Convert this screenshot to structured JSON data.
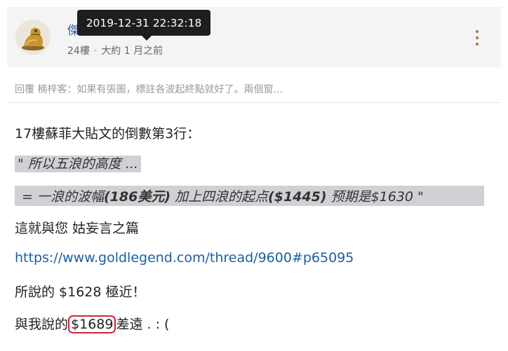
{
  "post": {
    "author": "傑",
    "floor": "24樓",
    "relative_time": "大約 1 月之前",
    "tooltip_datetime": "2019-12-31 22:32:18",
    "reply_preview": "回覆 楠梓客：如果有張圖，標註各波起終點就好了。兩個窗..."
  },
  "body": {
    "line1": "17樓蘇菲大貼文的倒數第3行：",
    "quote1": "\" 所以五浪的高度  ...",
    "quote2_a": "=   一浪的波幅",
    "quote2_b": "(186美元)",
    "quote2_c": "  加上四浪的起点",
    "quote2_d": "($1445)",
    "quote2_e": "  预期是$1630 \"",
    "line4": "這就與您 姑妄言之篇",
    "link": "https://www.goldlegend.com/thread/9600#p65095",
    "line6": "所說的 $1628 極近！",
    "line7_pre": "與我說的",
    "line7_circled": "$1689",
    "line7_post": "差遠 .      : ("
  },
  "colors": {
    "link": "#1a5fa8",
    "author": "#2c5ea6",
    "highlight": "#d2d0d5",
    "circle": "#d0243a"
  },
  "icons": [
    "avatar-gold-statue",
    "kebab-menu-icon"
  ]
}
